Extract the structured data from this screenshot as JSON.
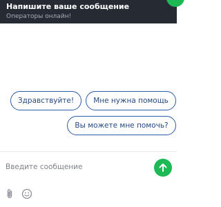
{
  "header": {
    "title": "Напишите ваше сообщение",
    "subtitle": "Операторы онлайн!"
  },
  "quick_replies": [
    "Здравствуйте!",
    "Мне нужна помощь",
    "Вы можете мне помочь?"
  ],
  "composer": {
    "placeholder": "Введите сообщение",
    "value": ""
  },
  "icons": {
    "send": "arrow-up-icon",
    "attach": "paperclip-icon",
    "emoji": "smiley-icon"
  },
  "colors": {
    "header_bg": "#262b33",
    "accent": "#1db954",
    "chip_border": "#2a5ba8"
  }
}
